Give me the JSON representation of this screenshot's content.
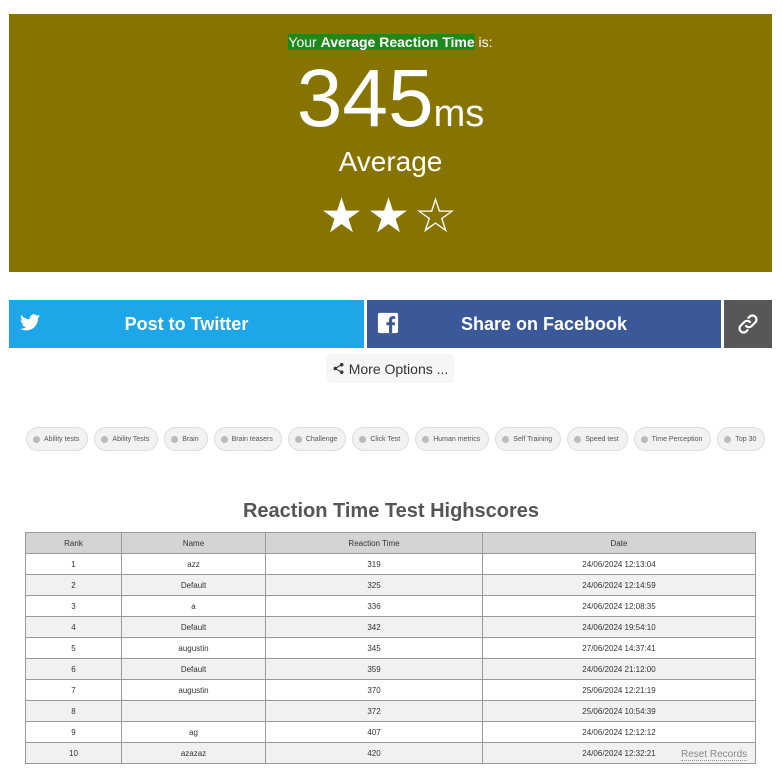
{
  "result": {
    "intro_prefix": "Your ",
    "intro_highlight": "Average Reaction Time",
    "intro_suffix": " is:",
    "score": "345",
    "unit": "ms",
    "rating": "Average",
    "stars_display": "★★☆",
    "stars_filled": 2,
    "stars_total": 3,
    "panel_color": "#877400"
  },
  "share": {
    "twitter_label": "Post to Twitter",
    "facebook_label": "Share on Facebook",
    "more_options_label": "More Options ...",
    "twitter_color": "#1da7e8",
    "facebook_color": "#3b5998"
  },
  "tags": [
    "Ability tests",
    "Ability Tests",
    "Brain",
    "Brain teasers",
    "Challenge",
    "Click Test",
    "Human metrics",
    "Self Training",
    "Speed test",
    "Time Perception",
    "Top 30"
  ],
  "highscores": {
    "title": "Reaction Time Test Highscores",
    "columns": [
      "Rank",
      "Name",
      "Reaction Time",
      "Date"
    ],
    "rows": [
      [
        "1",
        "azz",
        "319",
        "24/06/2024 12:13:04"
      ],
      [
        "2",
        "Default",
        "325",
        "24/06/2024 12:14:59"
      ],
      [
        "3",
        "a",
        "336",
        "24/06/2024 12:08:35"
      ],
      [
        "4",
        "Default",
        "342",
        "24/06/2024 19:54:10"
      ],
      [
        "5",
        "augustin",
        "345",
        "27/06/2024 14:37:41"
      ],
      [
        "6",
        "Default",
        "359",
        "24/06/2024 21:12:00"
      ],
      [
        "7",
        "augustin",
        "370",
        "25/06/2024 12:21:19"
      ],
      [
        "8",
        "",
        "372",
        "25/06/2024 10:54:39"
      ],
      [
        "9",
        "ag",
        "407",
        "24/06/2024 12:12:12"
      ],
      [
        "10",
        "azazaz",
        "420",
        "24/06/2024 12:32:21"
      ]
    ],
    "reset_label": "Reset Records"
  }
}
